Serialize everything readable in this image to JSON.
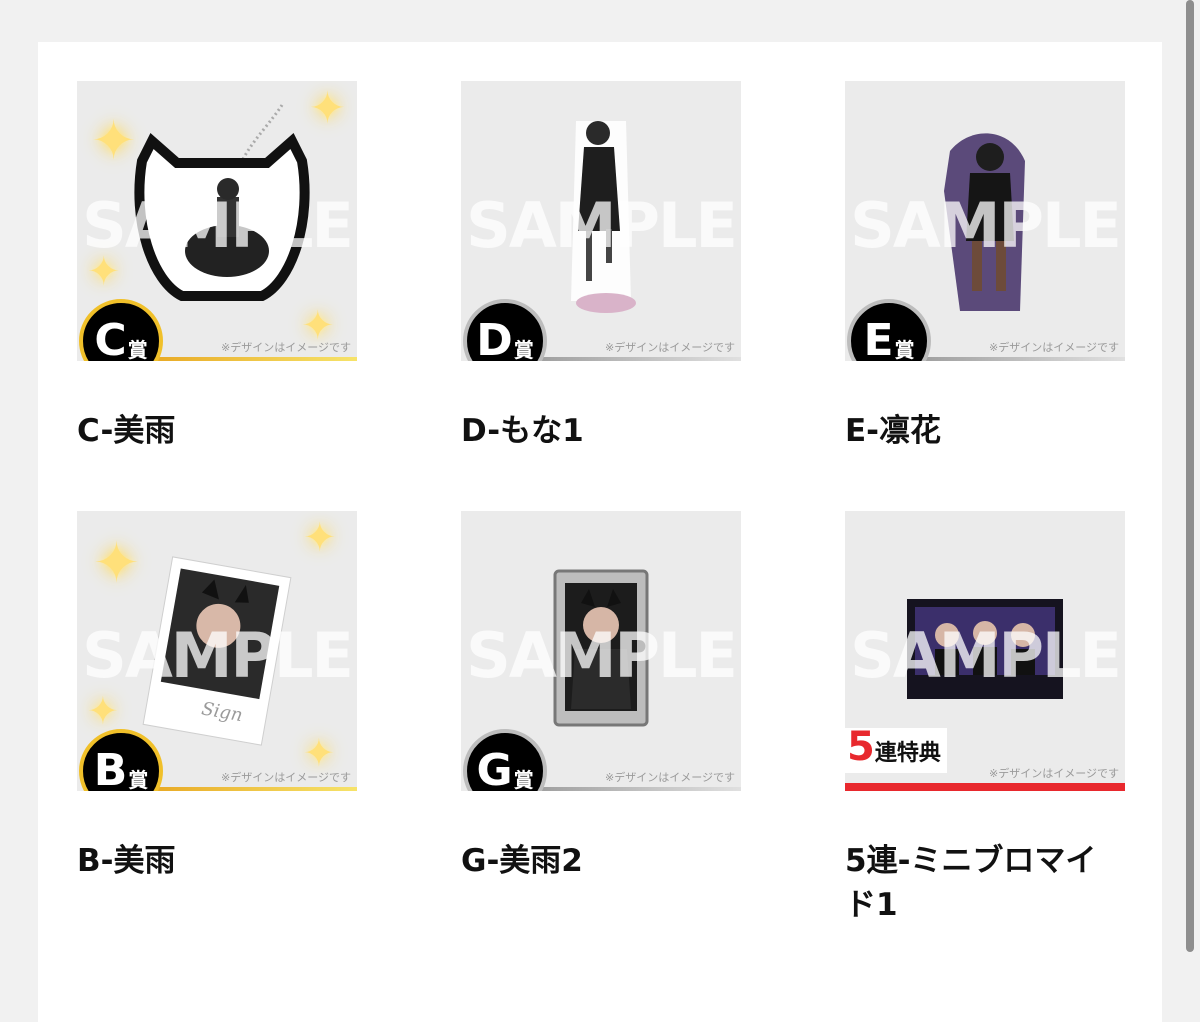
{
  "watermark": "SAMPLE",
  "image_note": "※デザインはイメージです",
  "items": [
    {
      "id": "c",
      "grade_letter": "C",
      "grade_suffix": "賞",
      "title": "C-美雨",
      "tier": "gold"
    },
    {
      "id": "d",
      "grade_letter": "D",
      "grade_suffix": "賞",
      "title": "D-もな1",
      "tier": "gray"
    },
    {
      "id": "e",
      "grade_letter": "E",
      "grade_suffix": "賞",
      "title": "E-凛花",
      "tier": "gray"
    },
    {
      "id": "b",
      "grade_letter": "B",
      "grade_suffix": "賞",
      "title": "B-美雨",
      "tier": "gold"
    },
    {
      "id": "g",
      "grade_letter": "G",
      "grade_suffix": "賞",
      "title": "G-美雨2",
      "tier": "gray"
    },
    {
      "id": "bonus5",
      "bonus_number": "5",
      "bonus_text": "連特典",
      "title": "5連-ミニブロマイド1",
      "tier": "red"
    }
  ],
  "colors": {
    "gold": "#f0c02a",
    "gray": "#bdbdbd",
    "red": "#e8282d"
  }
}
